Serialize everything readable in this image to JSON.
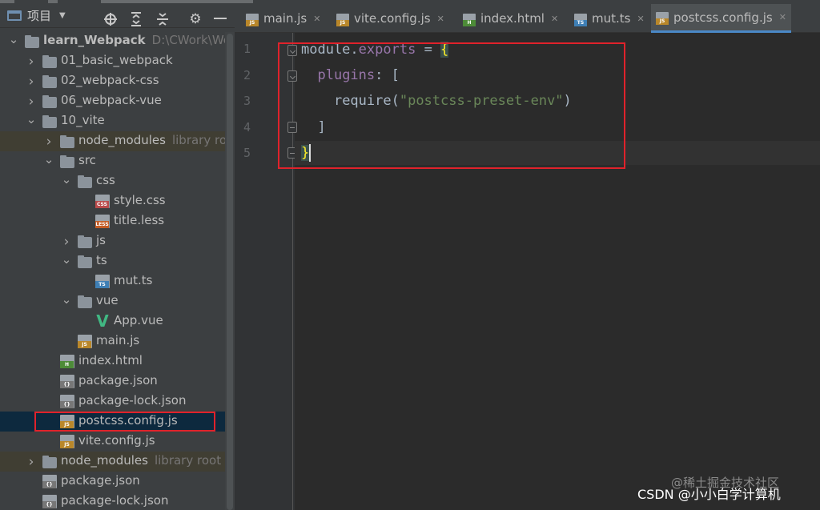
{
  "panel": {
    "title": "项目",
    "icons": [
      "locate-icon",
      "expand-all-icon",
      "collapse-all-icon",
      "settings-icon",
      "hide-icon"
    ]
  },
  "tree": [
    {
      "label": "learn_Webpack",
      "path": "D:\\CWork\\WebS",
      "kind": "folder",
      "depth": 0,
      "expanded": true,
      "bold": true
    },
    {
      "label": "01_basic_webpack",
      "kind": "folder",
      "depth": 1,
      "expanded": false
    },
    {
      "label": "02_webpack-css",
      "kind": "folder",
      "depth": 1,
      "expanded": false
    },
    {
      "label": "06_webpack-vue",
      "kind": "folder",
      "depth": 1,
      "expanded": false
    },
    {
      "label": "10_vite",
      "kind": "folder",
      "depth": 1,
      "expanded": true
    },
    {
      "label": "node_modules",
      "hint": "library root",
      "kind": "folder",
      "depth": 2,
      "expanded": false,
      "library": true
    },
    {
      "label": "src",
      "kind": "folder",
      "depth": 2,
      "expanded": true
    },
    {
      "label": "css",
      "kind": "folder",
      "depth": 3,
      "expanded": true
    },
    {
      "label": "style.css",
      "kind": "file",
      "tag": "CSS",
      "tagColor": "#b94c4c",
      "depth": 4
    },
    {
      "label": "title.less",
      "kind": "file",
      "tag": "LESS",
      "tagColor": "#c45d26",
      "depth": 4
    },
    {
      "label": "js",
      "kind": "folder",
      "depth": 3,
      "expanded": false
    },
    {
      "label": "ts",
      "kind": "folder",
      "depth": 3,
      "expanded": true
    },
    {
      "label": "mut.ts",
      "kind": "file",
      "tag": "TS",
      "tagColor": "#3f7fb5",
      "depth": 4
    },
    {
      "label": "vue",
      "kind": "folder",
      "depth": 3,
      "expanded": true
    },
    {
      "label": "App.vue",
      "kind": "vue",
      "depth": 4
    },
    {
      "label": "main.js",
      "kind": "file",
      "tag": "JS",
      "tagColor": "#b9872a",
      "depth": 3
    },
    {
      "label": "index.html",
      "kind": "file",
      "tag": "H",
      "tagColor": "#4d8b38",
      "depth": 2
    },
    {
      "label": "package.json",
      "kind": "file",
      "tag": "{}",
      "tagColor": "#777777",
      "depth": 2
    },
    {
      "label": "package-lock.json",
      "kind": "file",
      "tag": "{}",
      "tagColor": "#777777",
      "depth": 2
    },
    {
      "label": "postcss.config.js",
      "kind": "file",
      "tag": "JS",
      "tagColor": "#b9872a",
      "depth": 2,
      "selected": true
    },
    {
      "label": "vite.config.js",
      "kind": "file",
      "tag": "JS",
      "tagColor": "#b9872a",
      "depth": 2
    },
    {
      "label": "node_modules",
      "hint": "library root",
      "kind": "folder",
      "depth": 1,
      "expanded": false,
      "library": true
    },
    {
      "label": "package.json",
      "kind": "file",
      "tag": "{}",
      "tagColor": "#777777",
      "depth": 1
    },
    {
      "label": "package-lock.json",
      "kind": "file",
      "tag": "{}",
      "tagColor": "#777777",
      "depth": 1
    }
  ],
  "tabs": [
    {
      "label": "main.js",
      "tag": "JS",
      "tagColor": "#b9872a",
      "active": false
    },
    {
      "label": "vite.config.js",
      "tag": "JS",
      "tagColor": "#b9872a",
      "active": false
    },
    {
      "label": "index.html",
      "tag": "H",
      "tagColor": "#4d8b38",
      "active": false
    },
    {
      "label": "mut.ts",
      "tag": "TS",
      "tagColor": "#3f7fb5",
      "active": false
    },
    {
      "label": "postcss.config.js",
      "tag": "JS",
      "tagColor": "#b9872a",
      "active": true
    }
  ],
  "editor": {
    "line_numbers": [
      "1",
      "2",
      "3",
      "4",
      "5"
    ],
    "code": {
      "l1_obj": "module",
      "l1_dot": ".",
      "l1_prop": "exports",
      "l1_eq": " = ",
      "l1_brace": "{",
      "l2_key": "plugins",
      "l2_rest": ": [",
      "l3_fn": "require(",
      "l3_str": "\"postcss-preset-env\"",
      "l3_close": ")",
      "l4": "]",
      "l5_brace": "}"
    }
  },
  "watermark": {
    "main": "CSDN @小小白学计算机",
    "faint": "@稀土掘金技术社区"
  },
  "colors": {
    "highlight_box": "#e0222b",
    "selected_row": "#0d293e",
    "library_row": "#403e33",
    "accent_tab": "#4a88c7"
  }
}
